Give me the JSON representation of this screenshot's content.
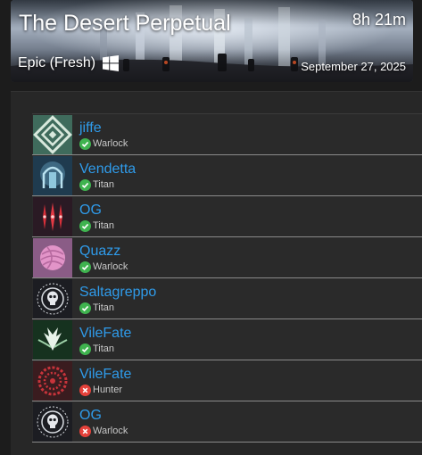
{
  "header": {
    "title": "The Desert Perpetual",
    "duration": "8h 21m",
    "mode": "Epic (Fresh)",
    "platform_icon": "windows-icon",
    "date": "September 27, 2025"
  },
  "colors": {
    "name": "#2f9bea",
    "complete": "#3fb34f",
    "incomplete": "#e5413a"
  },
  "players": [
    {
      "name": "jiffe",
      "class": "Warlock",
      "status": "complete",
      "emblem": "maze-emblem"
    },
    {
      "name": "Vendetta",
      "class": "Titan",
      "status": "complete",
      "emblem": "arch-emblem"
    },
    {
      "name": "OG",
      "class": "Titan",
      "status": "complete",
      "emblem": "red-daggers-emblem"
    },
    {
      "name": "Quazz",
      "class": "Warlock",
      "status": "complete",
      "emblem": "yarn-ball-emblem"
    },
    {
      "name": "Saltagreppo",
      "class": "Titan",
      "status": "complete",
      "emblem": "skull-emblem"
    },
    {
      "name": "VileFate",
      "class": "Titan",
      "status": "complete",
      "emblem": "green-wings-emblem"
    },
    {
      "name": "VileFate",
      "class": "Hunter",
      "status": "incomplete",
      "emblem": "red-cog-emblem"
    },
    {
      "name": "OG",
      "class": "Warlock",
      "status": "incomplete",
      "emblem": "skull-emblem"
    }
  ]
}
